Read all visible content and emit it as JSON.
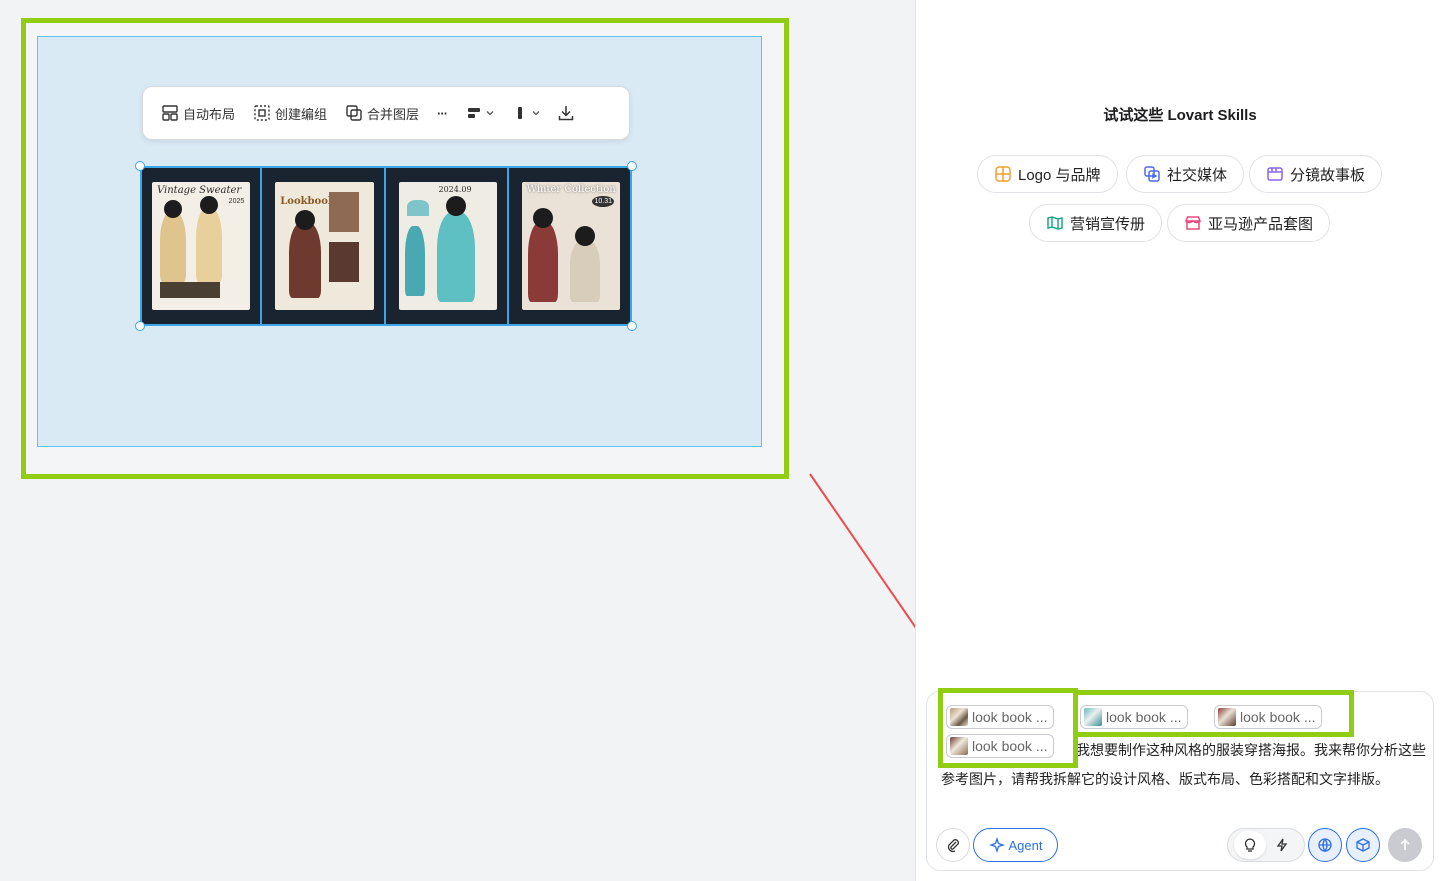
{
  "toolbar": {
    "auto_layout": "自动布局",
    "create_group": "创建编组",
    "merge_layers": "合并图层",
    "more": "···"
  },
  "posters": [
    {
      "title": "Vintage Sweater",
      "tag": "2025"
    },
    {
      "title": "Lookbook",
      "tag": ""
    },
    {
      "title": "2024.09",
      "tag": ""
    },
    {
      "title": "Winter Collection",
      "tag": "10.31"
    }
  ],
  "panel": {
    "skills_title": "试试这些 Lovart Skills",
    "chips": [
      {
        "label": "Logo 与品牌",
        "icon": "logo-brand-icon",
        "color": "#f0a030"
      },
      {
        "label": "社交媒体",
        "icon": "social-media-icon",
        "color": "#4a6cf0"
      },
      {
        "label": "分镜故事板",
        "icon": "storyboard-icon",
        "color": "#8a63f0"
      },
      {
        "label": "营销宣传册",
        "icon": "brochure-icon",
        "color": "#22a58c"
      },
      {
        "label": "亚马逊产品套图",
        "icon": "amazon-store-icon",
        "color": "#e84a7a"
      }
    ]
  },
  "composer": {
    "refs": [
      "look book ...",
      "look book ...",
      "look book ...",
      "look book ..."
    ],
    "prompt": "我想要制作这种风格的服装穿搭海报。我来帮你分析这些参考图片，请帮我拆解它的设计风格、版式布局、色彩搭配和文字排版。",
    "agent_label": "Agent"
  },
  "colors": {
    "highlight": "#8fcc12",
    "selection": "#3aa6e8",
    "arrow": "#f04a4a",
    "accent": "#2b6fe6"
  }
}
